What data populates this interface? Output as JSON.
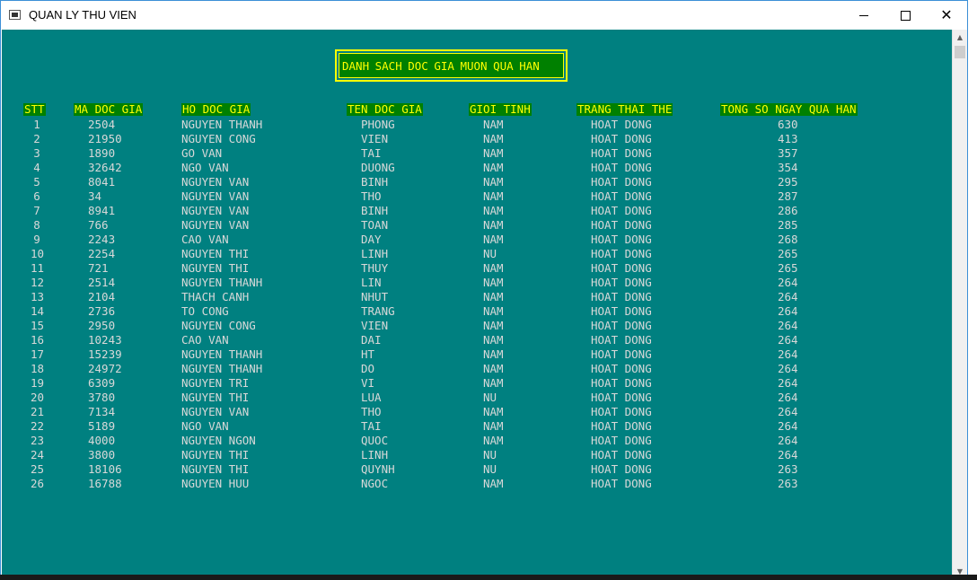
{
  "window": {
    "title": "QUAN LY THU VIEN",
    "minimize_glyph": "—",
    "maximize_glyph": "☐",
    "close_glyph": "✕",
    "icons": [
      "console-app-icon",
      "minimize-icon",
      "maximize-icon",
      "close-icon",
      "scroll-up-icon",
      "scroll-down-icon"
    ]
  },
  "console": {
    "heading": "DANH SACH DOC GIA MUON QUA HAN",
    "colors": {
      "background": "#008080",
      "header_bg": "#008000",
      "header_text": "#ffff00",
      "row_text": "#d8d8d8"
    },
    "columns": [
      "STT",
      "MA DOC GIA",
      "HO DOC GIA",
      "TEN DOC GIA",
      "GIOI TINH",
      "TRANG THAI THE",
      "TONG SO NGAY QUA HAN"
    ],
    "rows": [
      {
        "stt": "1",
        "ma": "2504",
        "ho": "NGUYEN THANH",
        "ten": "PHONG",
        "gt": "NAM",
        "tt": "HOAT DONG",
        "ngay": "630"
      },
      {
        "stt": "2",
        "ma": "21950",
        "ho": "NGUYEN CONG",
        "ten": "VIEN",
        "gt": "NAM",
        "tt": "HOAT DONG",
        "ngay": "413"
      },
      {
        "stt": "3",
        "ma": "1890",
        "ho": "GO VAN",
        "ten": "TAI",
        "gt": "NAM",
        "tt": "HOAT DONG",
        "ngay": "357"
      },
      {
        "stt": "4",
        "ma": "32642",
        "ho": "NGO VAN",
        "ten": "DUONG",
        "gt": "NAM",
        "tt": "HOAT DONG",
        "ngay": "354"
      },
      {
        "stt": "5",
        "ma": "8041",
        "ho": "NGUYEN VAN",
        "ten": "BINH",
        "gt": "NAM",
        "tt": "HOAT DONG",
        "ngay": "295"
      },
      {
        "stt": "6",
        "ma": "34",
        "ho": "NGUYEN VAN",
        "ten": "THO",
        "gt": "NAM",
        "tt": "HOAT DONG",
        "ngay": "287"
      },
      {
        "stt": "7",
        "ma": "8941",
        "ho": "NGUYEN VAN",
        "ten": "BINH",
        "gt": "NAM",
        "tt": "HOAT DONG",
        "ngay": "286"
      },
      {
        "stt": "8",
        "ma": "766",
        "ho": "NGUYEN VAN",
        "ten": "TOAN",
        "gt": "NAM",
        "tt": "HOAT DONG",
        "ngay": "285"
      },
      {
        "stt": "9",
        "ma": "2243",
        "ho": "CAO VAN",
        "ten": "DAY",
        "gt": "NAM",
        "tt": "HOAT DONG",
        "ngay": "268"
      },
      {
        "stt": "10",
        "ma": "2254",
        "ho": "NGUYEN THI",
        "ten": "LINH",
        "gt": "NU",
        "tt": "HOAT DONG",
        "ngay": "265"
      },
      {
        "stt": "11",
        "ma": "721",
        "ho": "NGUYEN THI",
        "ten": "THUY",
        "gt": "NAM",
        "tt": "HOAT DONG",
        "ngay": "265"
      },
      {
        "stt": "12",
        "ma": "2514",
        "ho": "NGUYEN THANH",
        "ten": "LIN",
        "gt": "NAM",
        "tt": "HOAT DONG",
        "ngay": "264"
      },
      {
        "stt": "13",
        "ma": "2104",
        "ho": "THACH CANH",
        "ten": "NHUT",
        "gt": "NAM",
        "tt": "HOAT DONG",
        "ngay": "264"
      },
      {
        "stt": "14",
        "ma": "2736",
        "ho": "TO CONG",
        "ten": "TRANG",
        "gt": "NAM",
        "tt": "HOAT DONG",
        "ngay": "264"
      },
      {
        "stt": "15",
        "ma": "2950",
        "ho": "NGUYEN CONG",
        "ten": "VIEN",
        "gt": "NAM",
        "tt": "HOAT DONG",
        "ngay": "264"
      },
      {
        "stt": "16",
        "ma": "10243",
        "ho": "CAO VAN",
        "ten": "DAI",
        "gt": "NAM",
        "tt": "HOAT DONG",
        "ngay": "264"
      },
      {
        "stt": "17",
        "ma": "15239",
        "ho": "NGUYEN THANH",
        "ten": "HT",
        "gt": "NAM",
        "tt": "HOAT DONG",
        "ngay": "264"
      },
      {
        "stt": "18",
        "ma": "24972",
        "ho": "NGUYEN THANH",
        "ten": "DO",
        "gt": "NAM",
        "tt": "HOAT DONG",
        "ngay": "264"
      },
      {
        "stt": "19",
        "ma": "6309",
        "ho": "NGUYEN TRI",
        "ten": "VI",
        "gt": "NAM",
        "tt": "HOAT DONG",
        "ngay": "264"
      },
      {
        "stt": "20",
        "ma": "3780",
        "ho": "NGUYEN THI",
        "ten": "LUA",
        "gt": "NU",
        "tt": "HOAT DONG",
        "ngay": "264"
      },
      {
        "stt": "21",
        "ma": "7134",
        "ho": "NGUYEN VAN",
        "ten": "THO",
        "gt": "NAM",
        "tt": "HOAT DONG",
        "ngay": "264"
      },
      {
        "stt": "22",
        "ma": "5189",
        "ho": "NGO VAN",
        "ten": "TAI",
        "gt": "NAM",
        "tt": "HOAT DONG",
        "ngay": "264"
      },
      {
        "stt": "23",
        "ma": "4000",
        "ho": "NGUYEN NGON",
        "ten": "QUOC",
        "gt": "NAM",
        "tt": "HOAT DONG",
        "ngay": "264"
      },
      {
        "stt": "24",
        "ma": "3800",
        "ho": "NGUYEN THI",
        "ten": "LINH",
        "gt": "NU",
        "tt": "HOAT DONG",
        "ngay": "264"
      },
      {
        "stt": "25",
        "ma": "18106",
        "ho": "NGUYEN THI",
        "ten": "QUYNH",
        "gt": "NU",
        "tt": "HOAT DONG",
        "ngay": "263"
      },
      {
        "stt": "26",
        "ma": "16788",
        "ho": "NGUYEN HUU",
        "ten": "NGOC",
        "gt": "NAM",
        "tt": "HOAT DONG",
        "ngay": "263"
      }
    ]
  }
}
